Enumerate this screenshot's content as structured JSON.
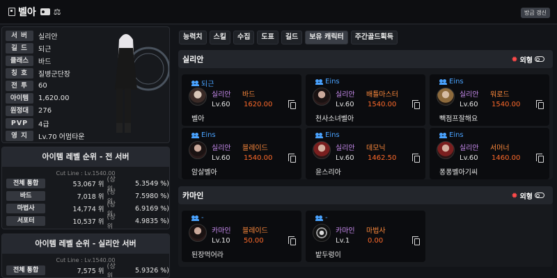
{
  "header": {
    "name": "벨아",
    "refresh_label": "방금 갱신"
  },
  "profile": {
    "rows": [
      {
        "label": "서 버",
        "value": "실리안"
      },
      {
        "label": "길 드",
        "value": "되근"
      },
      {
        "label": "클래스",
        "value": "바드"
      },
      {
        "label": "칭 호",
        "value": "질병군단장"
      },
      {
        "label": "전 투",
        "value": "60"
      },
      {
        "label": "아이템",
        "value": "1,620.00"
      },
      {
        "label": "원정대",
        "value": "276"
      },
      {
        "label": "PVP",
        "value": "4급"
      },
      {
        "label": "영 지",
        "value": "Lv.70 어멈타운"
      }
    ]
  },
  "ranking_all": {
    "title": "아이템 레벨 순위 - 전 서버",
    "cutline": "Cut Line : Lv.1540.00",
    "rows": [
      {
        "label": "전체 통합",
        "rank": "53,067 위",
        "top": "(상위",
        "pct": "5.3549 %)"
      },
      {
        "label": "바드",
        "rank": "7,018 위",
        "top": "(상위",
        "pct": "7.5980 %)"
      },
      {
        "label": "마법사",
        "rank": "14,774 위",
        "top": "(상위",
        "pct": "6.9169 %)"
      },
      {
        "label": "서포터",
        "rank": "10,537 위",
        "top": "(상위",
        "pct": "4.9835 %)"
      }
    ]
  },
  "ranking_server": {
    "title": "아이템 레벨 순위 - 실리안 서버",
    "cutline": "Cut Line : Lv.1540.00",
    "rows": [
      {
        "label": "전체 통합",
        "rank": "7,575 위",
        "top": "(상위",
        "pct": "5.9326 %)"
      }
    ]
  },
  "tabs": [
    "능력치",
    "스킬",
    "수집",
    "도표",
    "길드",
    "보유 캐릭터",
    "주간골드획득"
  ],
  "look_label": "외형",
  "servers": [
    {
      "name": "실리안",
      "characters": [
        {
          "guild": "되근",
          "server": "실리안",
          "class": "바드",
          "level": "Lv.60",
          "ilvl": "1620.00",
          "name": "벨아"
        },
        {
          "guild": "Eins",
          "server": "실리안",
          "class": "배틀마스터",
          "level": "Lv.60",
          "ilvl": "1540.00",
          "name": "천사소녀벨아"
        },
        {
          "guild": "Eins",
          "server": "실리안",
          "class": "워로드",
          "level": "Lv.60",
          "ilvl": "1540.00",
          "name": "빽점프잘해요"
        },
        {
          "guild": "Eins",
          "server": "실리안",
          "class": "블레이드",
          "level": "Lv.60",
          "ilvl": "1540.00",
          "name": "암살벨아"
        },
        {
          "guild": "Eins",
          "server": "실리안",
          "class": "데모닉",
          "level": "Lv.60",
          "ilvl": "1462.50",
          "name": "윤스리아"
        },
        {
          "guild": "Eins",
          "server": "실리안",
          "class": "서머너",
          "level": "Lv.60",
          "ilvl": "1460.00",
          "name": "퐁퐁벨아기씨"
        }
      ]
    },
    {
      "name": "카마인",
      "characters": [
        {
          "guild": "-",
          "server": "카마인",
          "class": "블레이드",
          "level": "Lv.10",
          "ilvl": "50.00",
          "name": "된장먹어라"
        },
        {
          "guild": "-",
          "server": "카마인",
          "class": "마법사",
          "level": "Lv.1",
          "ilvl": "0.00",
          "name": "밭두렁이"
        }
      ]
    }
  ]
}
